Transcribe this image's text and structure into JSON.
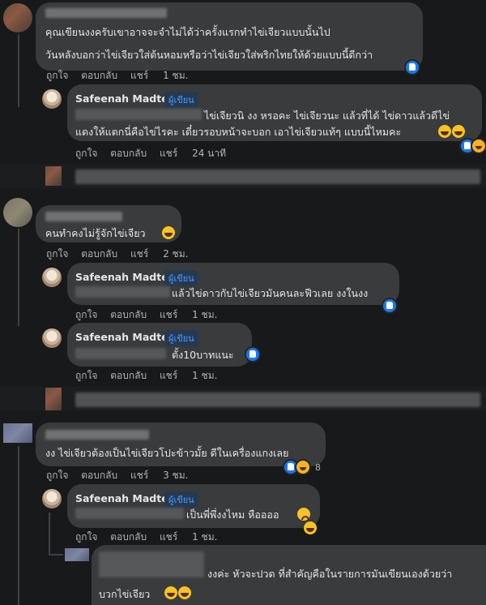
{
  "comments": [
    {
      "line1": "คุณเขียนงงครับเขาอาจจะจำไม่ได้ว่าครั้งแรกทำไข่เจียวแบบนั้นไป",
      "line2": "วันหลังบอกว่าไข่เจียวใส่ต้นหอมหรือว่าไข่เจียวใส่พริกไทยให้ด้วยแบบนี้ดีกว่า",
      "actions": {
        "like": "ถูกใจ",
        "reply": "ตอบกลับ",
        "share": "แชร์",
        "time": "1 ชม."
      },
      "replies": [
        {
          "name": "Safeenah Madteh",
          "badge": "ผู้เขียน",
          "line1": "ไข่เจียวนิ งง หรอคะ ไข่เจียวนะ แล้วที่ได้ ไข่ดาวแล้วดีไข่",
          "line2": "แดงให้แตกนี่คือไข่ไรคะ เดี๋ยวรอบหน้าจะบอก เอาไข่เจียวแท้ๆ แบบนี้ไหมคะ",
          "actions": {
            "like": "ถูกใจ",
            "reply": "ตอบกลับ",
            "share": "แชร์",
            "time": "24 นาที"
          }
        }
      ]
    },
    {
      "line1": "คนทำคงไม่รู้จักไข่เจียว",
      "actions": {
        "like": "ถูกใจ",
        "reply": "ตอบกลับ",
        "share": "แชร์",
        "time": "2 ชม."
      },
      "replies": [
        {
          "name": "Safeenah Madteh",
          "badge": "ผู้เขียน",
          "line1": "แล้วไข่ดาวกับไข่เจียวมันคนละฟีวเลย งงในงง",
          "actions": {
            "like": "ถูกใจ",
            "reply": "ตอบกลับ",
            "share": "แชร์",
            "time": "1 ชม."
          }
        },
        {
          "name": "Safeenah Madteh",
          "badge": "ผู้เขียน",
          "line1": "ตั้ง10บาทแนะ",
          "actions": {
            "like": "ถูกใจ",
            "reply": "ตอบกลับ",
            "share": "แชร์",
            "time": "1 ชม."
          }
        }
      ]
    },
    {
      "line1": "งง ไข่เจียวต้องเป็นไข่เจียวโปะข้าวมั้ย ดีในเครื่องแกงเลย",
      "reaction_count": "8",
      "actions": {
        "like": "ถูกใจ",
        "reply": "ตอบกลับ",
        "share": "แชร์",
        "time": "3 ชม."
      },
      "replies": [
        {
          "name": "Safeenah Madteh",
          "badge": "ผู้เขียน",
          "line1": "เป็นพี่พึ่งงไหม หืออออ",
          "actions": {
            "like": "ถูกใจ",
            "reply": "ตอบกลับ",
            "share": "แชร์",
            "time": "1 ชม."
          }
        },
        {
          "line1": "งงค่ะ หัวจะปวด ที่สำคัญคือในรายการมันเขียนเองด้วยว่า",
          "line2": "บวกไข่เจียว"
        }
      ]
    }
  ],
  "icons": {
    "like": "like-reaction-icon",
    "haha": "haha-reaction-icon",
    "laugh": "laughing-emoji-icon",
    "sad": "sad-emoji-icon"
  },
  "colors": {
    "background": "#18191a",
    "bubble": "#3a3b3c",
    "author_badge": "#4599ff",
    "like_blue": "#1877f2"
  }
}
